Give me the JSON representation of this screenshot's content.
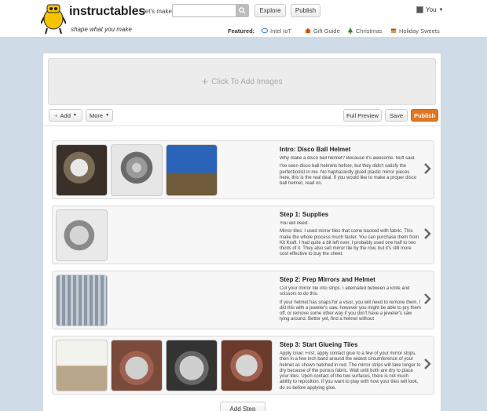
{
  "header": {
    "logo_text": "instructables",
    "tagline": "shape what you make",
    "lets_make": "let's make",
    "search_value": "",
    "explore_label": "Explore",
    "publish_label": "Publish",
    "user_label": "You",
    "featured_label": "Featured:",
    "featured": [
      {
        "label": "Intel IoT",
        "icon": "intel-logo-icon"
      },
      {
        "label": "Gift Guide",
        "icon": "gift-icon"
      },
      {
        "label": "Christmas",
        "icon": "tree-icon"
      },
      {
        "label": "Holiday Sweets",
        "icon": "sweets-icon"
      }
    ]
  },
  "editor": {
    "dropzone_label": "Click To Add Images",
    "add_label": "Add",
    "more_label": "More",
    "preview_label": "Full Preview",
    "save_label": "Save",
    "publish_label": "Publish",
    "add_step_label": "Add Step"
  },
  "steps": [
    {
      "title": "Intro: Disco Ball Helmet",
      "paragraphs": [
        "Why make a disco ball helmet? Because it's awesome. Nuff said.",
        "I've seen disco ball helmets before, but they didn't satisfy the perfectionist in me. No haphazardly glued plastic mirror pieces here, this is the real deal. If you would like to make a proper disco ball helmet, read on."
      ]
    },
    {
      "title": "Step 1: Supplies",
      "paragraphs": [
        "You will need:",
        "Mirror tiles: I used mirror tiles that come backed with fabric. This make the whole process much faster. You can purchase them from Kit Kraft. I had quite a bit left over, I probably used one half to two thirds of it. They also sell mirror tile by the row, but it's still more cost effective to buy the sheet."
      ]
    },
    {
      "title": "Step 2: Prep Mirrors and Helmet",
      "paragraphs": [
        "Cut your mirror tile into strips. I alternated between a knife and scissors to do this.",
        "If your helmet has snaps for a visor, you will need to remove them. I did this with a jeweler's saw, however you might be able to pry them off, or remove some other way if you don't have a jeweler's saw lying around. Better yet, find a helmet without"
      ]
    },
    {
      "title": "Step 3: Start Glueing Tiles",
      "paragraphs": [
        "Apply Glue: First, apply contact glue to a few of your mirror strips, then in a few inch band around the widest circumference of your helmet as shown hatched in red. The mirror strips will take longer to dry because of the porous fabric. Wait until both are dry to place your tiles. Upon contact of the two surfaces, there is not much ability to reposition. If you want to play with how your tiles will look, do so before applying glue."
      ]
    }
  ]
}
